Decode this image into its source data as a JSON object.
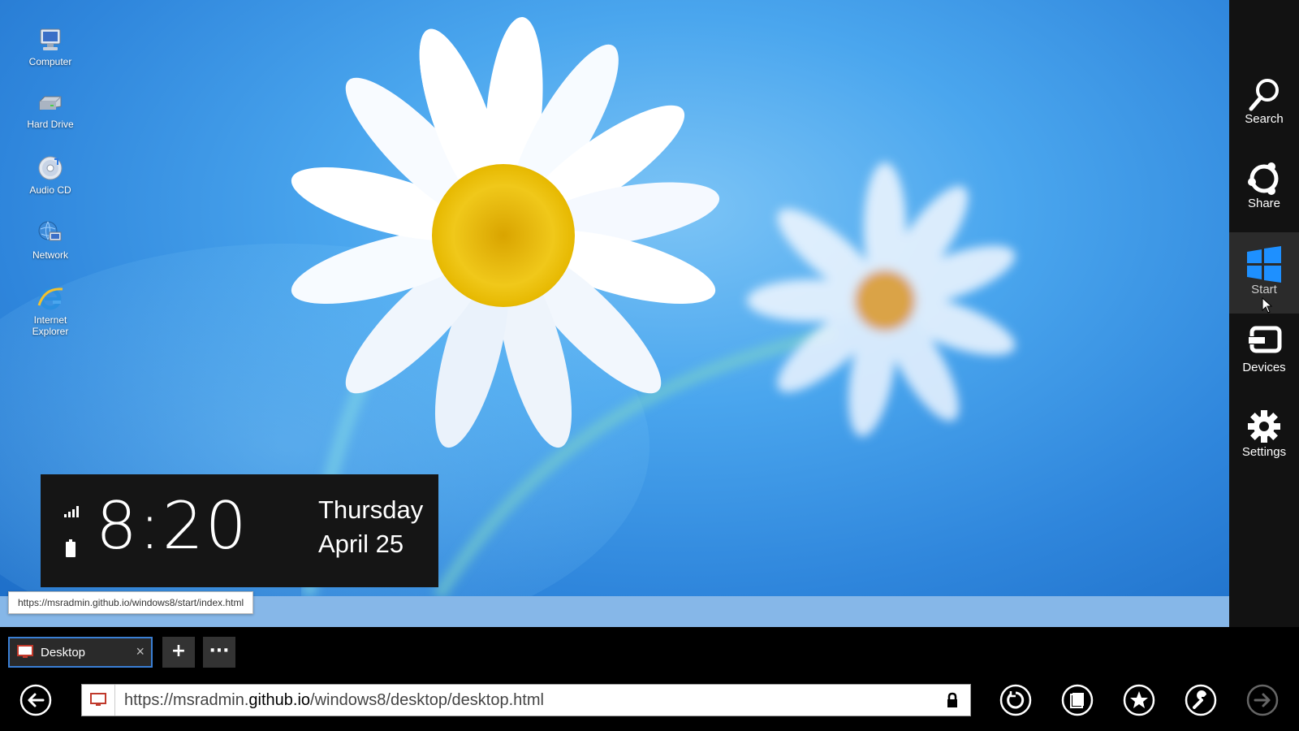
{
  "desktop": {
    "icons": [
      {
        "label": "Computer",
        "icon": "computer-icon"
      },
      {
        "label": "Hard Drive",
        "icon": "hard-drive-icon"
      },
      {
        "label": "Audio CD",
        "icon": "audio-cd-icon"
      },
      {
        "label": "Network",
        "icon": "network-icon"
      },
      {
        "label": "Internet Explorer",
        "icon": "internet-explorer-icon"
      }
    ],
    "wallpaper": "daisy-flowers-on-blue"
  },
  "clock": {
    "time": "8:20",
    "day": "Thursday",
    "date": "April 25",
    "signal_icon": "signal-icon",
    "battery_icon": "battery-icon"
  },
  "tooltip": {
    "text": "https://msradmin.github.io/windows8/start/index.html"
  },
  "charms": [
    {
      "label": "Search",
      "icon": "search-icon"
    },
    {
      "label": "Share",
      "icon": "share-icon"
    },
    {
      "label": "Start",
      "icon": "windows-logo-icon",
      "active": true
    },
    {
      "label": "Devices",
      "icon": "devices-icon"
    },
    {
      "label": "Settings",
      "icon": "gear-icon"
    }
  ],
  "browser": {
    "tab": {
      "label": "Desktop",
      "close": "×"
    },
    "new_tab_label": "+",
    "more_label": "···",
    "address": {
      "prefix": "https://msradmin.",
      "domain": "github.io",
      "suffix": "/windows8/desktop/desktop.html"
    }
  },
  "colors": {
    "charm_bar": "#121212",
    "tab_border": "#3a7fd5",
    "desktop_blue": "#4aa6ee"
  }
}
